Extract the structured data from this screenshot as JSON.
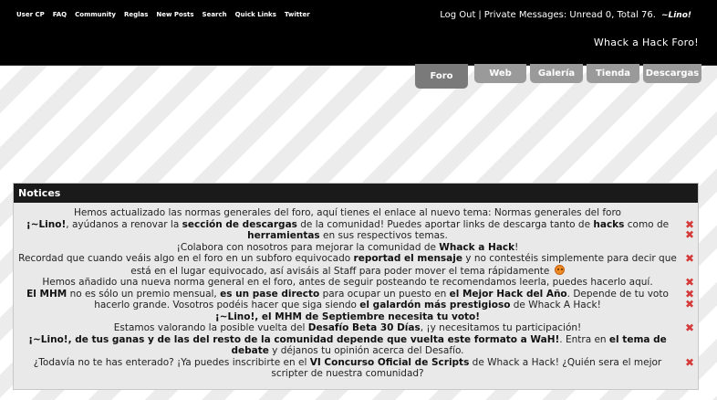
{
  "header": {
    "links": [
      "User CP",
      "FAQ",
      "Community",
      "Reglas",
      "New Posts",
      "Search",
      "Quick Links",
      "Twitter"
    ],
    "logout": "Log Out",
    "separator": "|",
    "private_messages": "Private Messages: Unread 0, Total 76.",
    "username": "~Lino!",
    "welcome": "Whack a Hack Foro!"
  },
  "tabs": [
    {
      "label": "Foro",
      "active": true
    },
    {
      "label": "Web",
      "active": false
    },
    {
      "label": "Galería",
      "active": false
    },
    {
      "label": "Tienda",
      "active": false
    },
    {
      "label": "Descargas",
      "active": false
    }
  ],
  "notices": {
    "title": "Notices",
    "dismiss_icon": "✖",
    "items": [
      {
        "t1": "Hemos actualizado las normas generales del foro, aquí tienes el enlace al nuevo tema: Normas generales del foro"
      },
      {
        "b1": "¡~Lino!",
        "t1": ", ayúdanos a renovar la ",
        "b2": "sección de descargas",
        "t2": " de la comunidad! Puedes aportar links de descarga tanto de ",
        "b3": "hacks",
        "t3": " como de ",
        "b4": "herramientas",
        "t4": " en sus respectivos temas.",
        "t5": "¡Colabora con nosotros para mejorar la comunidad de ",
        "b5": "Whack a Hack",
        "t6": "!"
      },
      {
        "t1": "Recordad que cuando veáis algo en el foro en un subforo equivocado ",
        "b1": "reportad el mensaje",
        "t2": " y no contestéis simplemente para decir que está en el lugar equivocado, así avisáis al Staff para poder mover el tema rápidamente"
      },
      {
        "t1": "Hemos añadido una nueva norma general en el foro, antes de seguir posteando te recomendamos leerla, puedes hacerlo aquí."
      },
      {
        "b1": "El MHM",
        "t1": " no es sólo un premio mensual, ",
        "b2": "es un pase directo",
        "t2": " para ocupar un puesto en ",
        "b3": "el Mejor Hack del Año",
        "t3": ". Depende de tu voto hacerlo grande. Vosotros podéis hacer que siga siendo ",
        "b4": "el galardón más prestigioso",
        "t4": " de Whack A Hack!",
        "b5": "¡~Lino!, el MHM de Septiembre necesita tu voto!"
      },
      {
        "t1": "Estamos valorando la posible vuelta del ",
        "b1": "Desafío Beta 30 Días",
        "t2": ", ¡y necesitamos tu participación!"
      },
      {
        "b1": "¡~Lino!, de tus ganas y de las del resto de la comunidad depende que vuelta este formato a WaH!",
        "t1": ". Entra en ",
        "b2": "el tema de debate",
        "t2": " y déjanos tu opinión acerca del Desafío."
      },
      {
        "t1": "¿Todavía no te has enterado? ¡Ya puedes inscribirte en el ",
        "b1": "VI Concurso Oficial de Scripts",
        "t2": " de Whack a Hack! ¿Quién sera el mejor scripter de nuestra comunidad?"
      }
    ]
  }
}
